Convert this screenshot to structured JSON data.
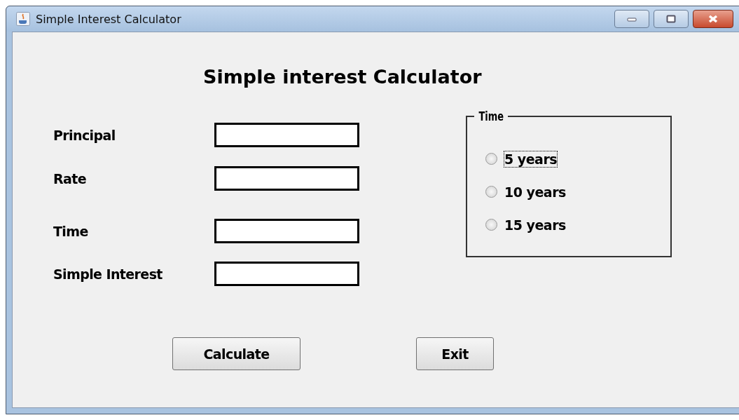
{
  "window": {
    "title": "Simple Interest Calculator"
  },
  "heading": "Simple interest Calculator",
  "fields": [
    {
      "label": "Principal"
    },
    {
      "label": "Rate"
    },
    {
      "label": "Time"
    },
    {
      "label": "Simple Interest"
    }
  ],
  "time_group": {
    "title": "Time",
    "options": [
      {
        "label": "5 years",
        "selected": false,
        "focused": true
      },
      {
        "label": "10 years",
        "selected": false,
        "focused": false
      },
      {
        "label": "15 years",
        "selected": false,
        "focused": false
      }
    ]
  },
  "buttons": [
    "Calculate",
    "Exit"
  ]
}
